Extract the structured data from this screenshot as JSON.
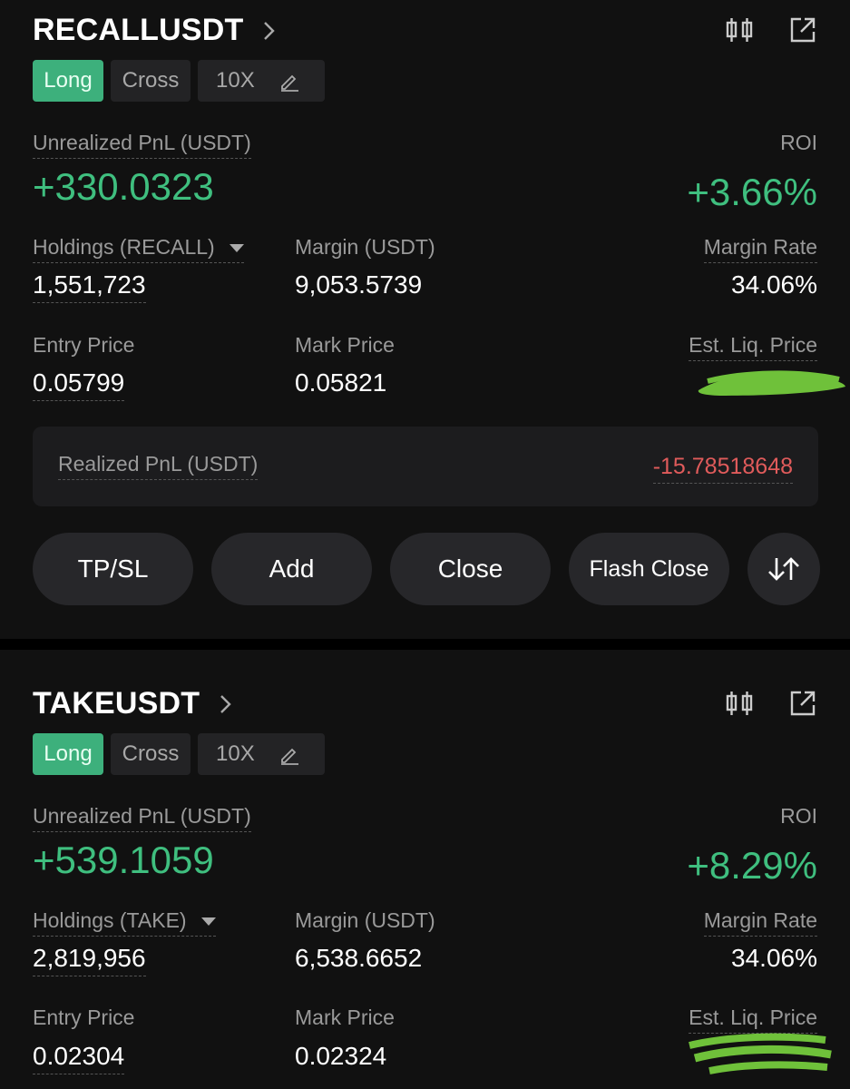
{
  "positions": [
    {
      "symbol": "RECALLUSDT",
      "side": "Long",
      "margin_mode": "Cross",
      "leverage": "10X",
      "unrealized_label": "Unrealized PnL (USDT)",
      "unrealized_value": "+330.0323",
      "roi_label": "ROI",
      "roi_value": "+3.66%",
      "holdings_label": "Holdings (RECALL)",
      "holdings_value": "1,551,723",
      "margin_label": "Margin (USDT)",
      "margin_value": "9,053.5739",
      "margin_rate_label": "Margin Rate",
      "margin_rate_value": "34.06%",
      "entry_label": "Entry Price",
      "entry_value": "0.05799",
      "mark_label": "Mark Price",
      "mark_value": "0.05821",
      "liq_label": "Est. Liq. Price",
      "realized_label": "Realized PnL (USDT)",
      "realized_value": "-15.78518648",
      "buttons": {
        "tpsl": "TP/SL",
        "add": "Add",
        "close": "Close",
        "flash_close": "Flash Close",
        "swap": "↓↑"
      }
    },
    {
      "symbol": "TAKEUSDT",
      "side": "Long",
      "margin_mode": "Cross",
      "leverage": "10X",
      "unrealized_label": "Unrealized PnL (USDT)",
      "unrealized_value": "+539.1059",
      "roi_label": "ROI",
      "roi_value": "+8.29%",
      "holdings_label": "Holdings (TAKE)",
      "holdings_value": "2,819,956",
      "margin_label": "Margin (USDT)",
      "margin_value": "6,538.6652",
      "margin_rate_label": "Margin Rate",
      "margin_rate_value": "34.06%",
      "entry_label": "Entry Price",
      "entry_value": "0.02304",
      "mark_label": "Mark Price",
      "mark_value": "0.02324",
      "liq_label": "Est. Liq. Price"
    }
  ],
  "colors": {
    "background": "#111111",
    "profit_green": "#3fbf7f",
    "long_tag": "#3db07c",
    "loss_red": "#e05b5b",
    "redaction_green": "#6fc13a"
  },
  "icons": [
    "chevron-right-icon",
    "candlestick-chart-icon",
    "external-link-icon",
    "edit-pencil-icon",
    "swap-arrows-icon"
  ]
}
